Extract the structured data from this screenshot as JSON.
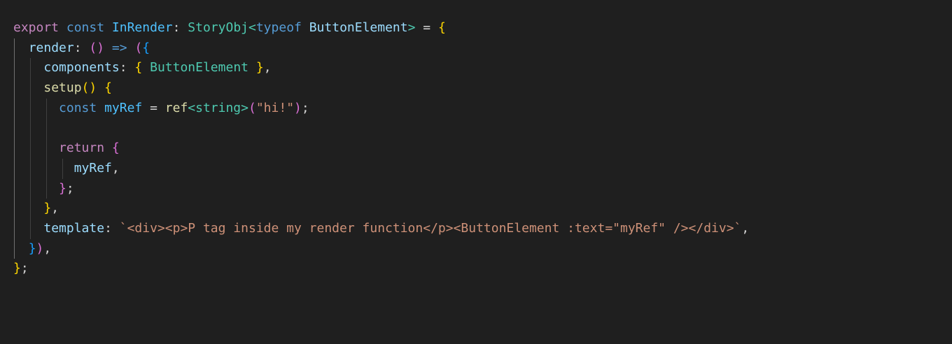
{
  "editor": {
    "theme": "dark",
    "background": "#1f1f1f",
    "language": "typescript",
    "lines": [
      "export const InRender: StoryObj<typeof ButtonElement> = {",
      "  render: () => ({",
      "    components: { ButtonElement },",
      "    setup() {",
      "      const myRef = ref<string>(\"hi!\");",
      "",
      "      return {",
      "        myRef,",
      "      };",
      "    },",
      "    template: `<div><p>P tag inside my render function</p><ButtonElement :text=\"myRef\" /></div>`,",
      "  }),",
      "};"
    ]
  },
  "tokens": {
    "l1": [
      "export",
      " ",
      "const",
      " ",
      "InRender",
      ": ",
      "StoryObj",
      "<",
      "typeof",
      " ",
      "ButtonElement",
      ">",
      " = ",
      "{"
    ],
    "l2": [
      "  ",
      "render",
      ": ",
      "()",
      " => ",
      "(",
      "{"
    ],
    "l3": [
      "    ",
      "components",
      ": ",
      "{",
      " ",
      "ButtonElement",
      " ",
      "}",
      ","
    ],
    "l4": [
      "    ",
      "setup",
      "()",
      " ",
      "{"
    ],
    "l5": [
      "      ",
      "const",
      " ",
      "myRef",
      " = ",
      "ref",
      "<",
      "string",
      ">",
      "(",
      "\"hi!\"",
      ")",
      ";"
    ],
    "l6": [
      ""
    ],
    "l7": [
      "      ",
      "return",
      " ",
      "{"
    ],
    "l8": [
      "        ",
      "myRef",
      ","
    ],
    "l9": [
      "      ",
      "}",
      ";"
    ],
    "l10": [
      "    ",
      "}",
      ","
    ],
    "l11": [
      "    ",
      "template",
      ": ",
      "`<div><p>P tag inside my render function</p><ButtonElement :text=\"myRef\" /></div>`",
      ","
    ],
    "l12": [
      "  ",
      "}",
      ")",
      ","
    ],
    "l13": [
      "}",
      ";"
    ]
  },
  "colors": {
    "keyword": "#569cd6",
    "control_keyword": "#c586c0",
    "variable": "#9cdcfe",
    "constant": "#4fc1ff",
    "type": "#4ec9b0",
    "function": "#dcdcaa",
    "string": "#ce9178",
    "bracket_1": "#ffd700",
    "bracket_2": "#da70d6",
    "bracket_3": "#179fff"
  }
}
